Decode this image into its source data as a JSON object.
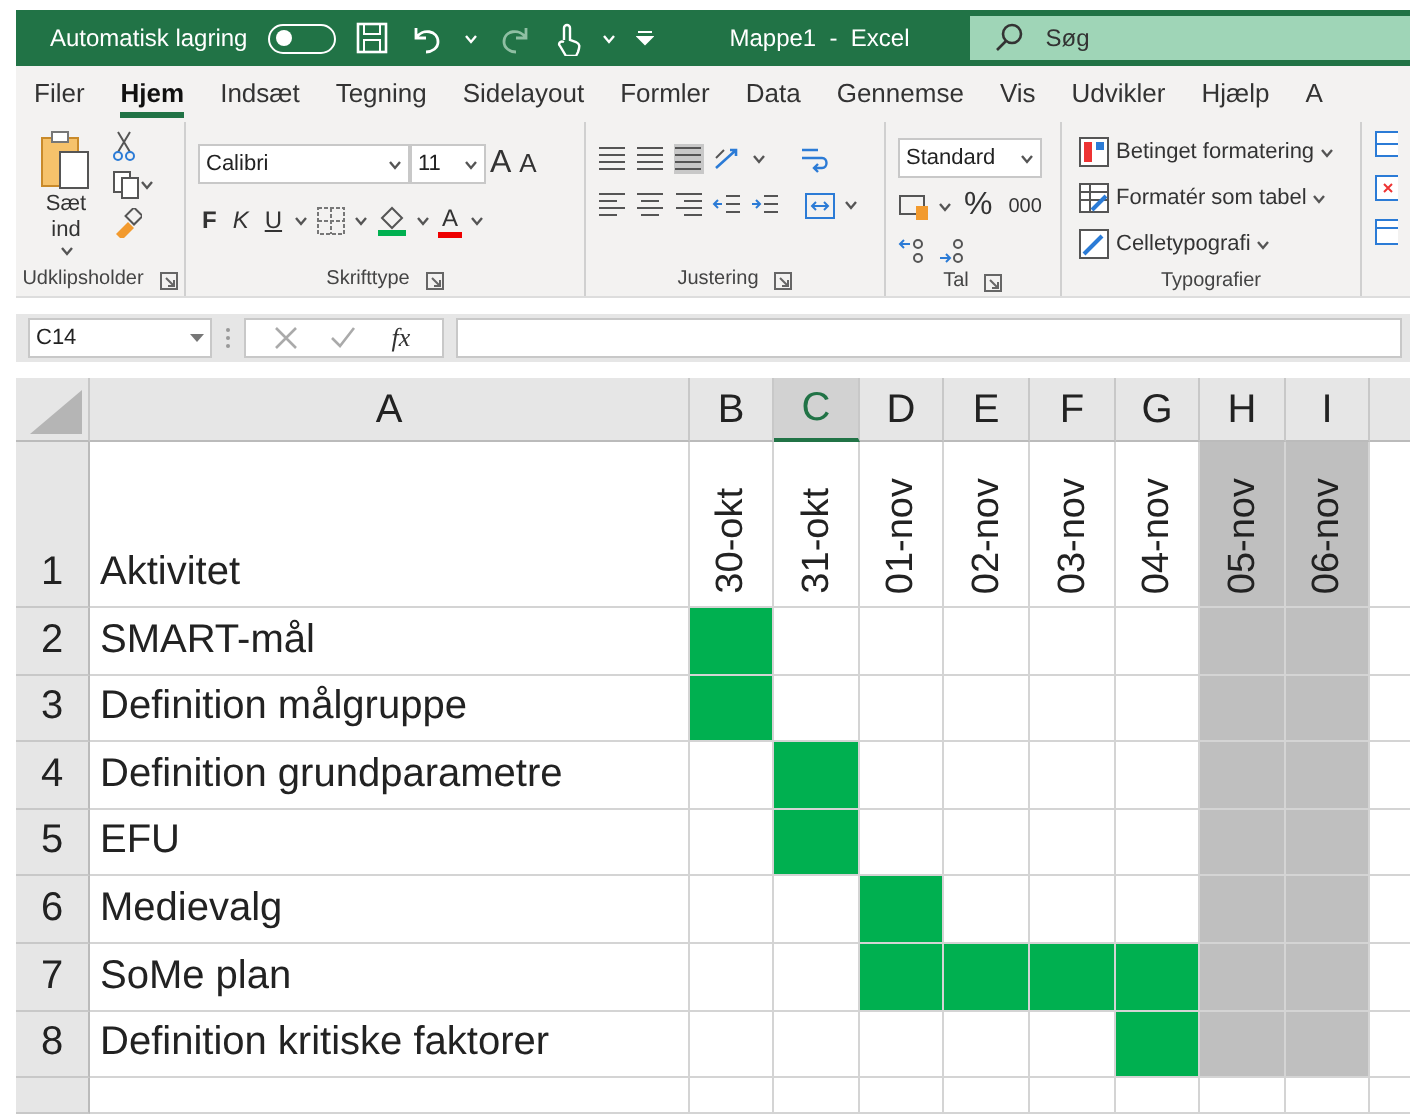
{
  "title_bar": {
    "autosave_label": "Automatisk lagring",
    "autosave_on": false,
    "document_title": "Mappe1  -  Excel",
    "search_placeholder": "Søg"
  },
  "ribbon_tabs": [
    {
      "label": "Filer",
      "selected": false
    },
    {
      "label": "Hjem",
      "selected": true
    },
    {
      "label": "Indsæt",
      "selected": false
    },
    {
      "label": "Tegning",
      "selected": false
    },
    {
      "label": "Sidelayout",
      "selected": false
    },
    {
      "label": "Formler",
      "selected": false
    },
    {
      "label": "Data",
      "selected": false
    },
    {
      "label": "Gennemse",
      "selected": false
    },
    {
      "label": "Vis",
      "selected": false
    },
    {
      "label": "Udvikler",
      "selected": false
    },
    {
      "label": "Hjælp",
      "selected": false
    },
    {
      "label": "A",
      "selected": false
    }
  ],
  "ribbon": {
    "clipboard": {
      "paste_label": "Sæt ind",
      "group_label": "Udklipsholder"
    },
    "font": {
      "font_name": "Calibri",
      "font_size": "11",
      "grow": "A",
      "shrink": "A",
      "bold": "F",
      "italic": "K",
      "underline": "U",
      "font_color": "A",
      "group_label": "Skrifttype"
    },
    "alignment": {
      "group_label": "Justering"
    },
    "number": {
      "format": "Standard",
      "percent": "%",
      "thousands": "000",
      "group_label": "Tal"
    },
    "styles": {
      "items": [
        "Betinget formatering",
        "Formatér som tabel",
        "Celletypografi"
      ],
      "group_label": "Typografier"
    }
  },
  "formula_bar": {
    "name_box": "C14",
    "fx": "fx"
  },
  "sheet": {
    "columns": [
      {
        "letter": "A",
        "selected": false,
        "shaded": false
      },
      {
        "letter": "B",
        "selected": false,
        "shaded": false
      },
      {
        "letter": "C",
        "selected": true,
        "shaded": false
      },
      {
        "letter": "D",
        "selected": false,
        "shaded": false
      },
      {
        "letter": "E",
        "selected": false,
        "shaded": false
      },
      {
        "letter": "F",
        "selected": false,
        "shaded": false
      },
      {
        "letter": "G",
        "selected": false,
        "shaded": false
      },
      {
        "letter": "H",
        "selected": false,
        "shaded": true
      },
      {
        "letter": "I",
        "selected": false,
        "shaded": true
      }
    ],
    "header_row": {
      "number": "1",
      "label": "Aktivitet",
      "dates": [
        "30-okt",
        "31-okt",
        "01-nov",
        "02-nov",
        "03-nov",
        "04-nov",
        "05-nov",
        "06-nov"
      ]
    },
    "rows": [
      {
        "number": "2",
        "activity": "SMART-mål",
        "filled": [
          true,
          false,
          false,
          false,
          false,
          false,
          false,
          false
        ]
      },
      {
        "number": "3",
        "activity": "Definition målgruppe",
        "filled": [
          true,
          false,
          false,
          false,
          false,
          false,
          false,
          false
        ]
      },
      {
        "number": "4",
        "activity": "Definition grundparametre",
        "filled": [
          false,
          true,
          false,
          false,
          false,
          false,
          false,
          false
        ]
      },
      {
        "number": "5",
        "activity": "EFU",
        "filled": [
          false,
          true,
          false,
          false,
          false,
          false,
          false,
          false
        ]
      },
      {
        "number": "6",
        "activity": "Medievalg",
        "filled": [
          false,
          false,
          true,
          false,
          false,
          false,
          false,
          false
        ]
      },
      {
        "number": "7",
        "activity": "SoMe plan",
        "filled": [
          false,
          false,
          true,
          true,
          true,
          true,
          false,
          false
        ]
      },
      {
        "number": "8",
        "activity": "Definition kritiske faktorer",
        "filled": [
          false,
          false,
          false,
          false,
          false,
          true,
          false,
          false
        ]
      }
    ]
  }
}
